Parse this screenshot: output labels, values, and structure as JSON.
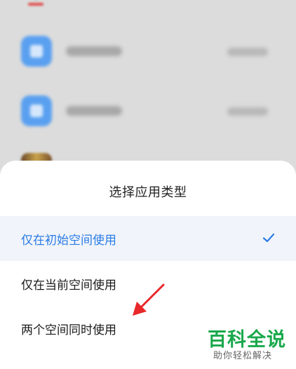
{
  "sheet": {
    "title": "选择应用类型",
    "options": [
      {
        "label": "仅在初始空间使用",
        "selected": true
      },
      {
        "label": "仅在当前空间使用",
        "selected": false
      },
      {
        "label": "两个空间同时使用",
        "selected": false
      }
    ]
  },
  "colors": {
    "accent": "#2b7ce6",
    "selected_background": "#f1f4fa",
    "annotation_arrow": "#e8282b",
    "watermark_green": "#19a84b"
  },
  "watermark": {
    "title": "百科全说",
    "subtitle": "助你轻松解决"
  },
  "icons": {
    "check": "check-icon",
    "annotation": "red-arrow-icon"
  }
}
